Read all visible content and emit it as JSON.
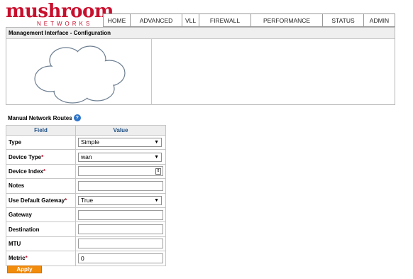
{
  "brand": {
    "name": "mushroom",
    "tagline": "NETWORKS",
    "accent": "#c8102e"
  },
  "nav": {
    "items": [
      "HOME",
      "ADVANCED",
      "VLL",
      "FIREWALL",
      "PERFORMANCE",
      "STATUS",
      "ADMIN"
    ]
  },
  "panel": {
    "title": "Management Interface - Configuration",
    "image_icon": "cloud-icon"
  },
  "routes": {
    "title": "Manual Network Routes",
    "help_icon": "help-icon",
    "headers": {
      "field": "Field",
      "value": "Value"
    },
    "fields": {
      "type": {
        "label": "Type",
        "value": "Simple"
      },
      "device_type": {
        "label": "Device Type",
        "value": "wan"
      },
      "device_index": {
        "label": "Device Index",
        "value": ""
      },
      "notes": {
        "label": "Notes",
        "value": ""
      },
      "default_gateway": {
        "label": "Use Default Gateway",
        "value": "True"
      },
      "gateway": {
        "label": "Gateway",
        "value": ""
      },
      "destination": {
        "label": "Destination",
        "value": ""
      },
      "mtu": {
        "label": "MTU",
        "value": ""
      },
      "metric": {
        "label": "Metric",
        "value": "0"
      }
    },
    "required_marker": "*",
    "apply_label": "Apply",
    "apply_color": "#f28c0d"
  }
}
